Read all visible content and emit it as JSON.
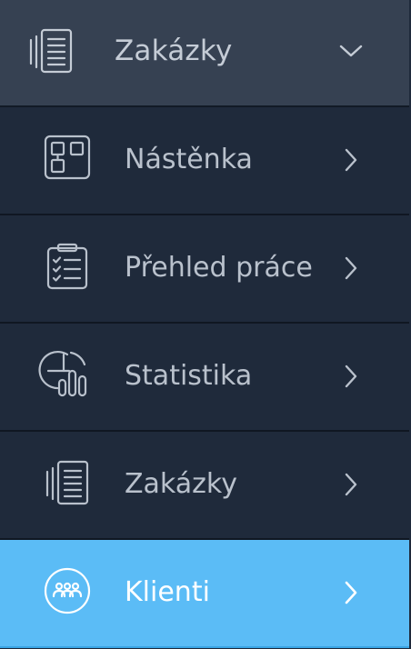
{
  "header": {
    "label": "Zakázky",
    "icon": "document-list-icon",
    "chevron": "chevron-down-icon"
  },
  "items": [
    {
      "label": "Nástěnka",
      "icon": "dashboard-icon",
      "chevron": "chevron-right-icon",
      "active": false
    },
    {
      "label": "Přehled práce",
      "icon": "clipboard-checklist-icon",
      "chevron": "chevron-right-icon",
      "active": false
    },
    {
      "label": "Statistika",
      "icon": "pie-bar-chart-icon",
      "chevron": "chevron-right-icon",
      "active": false
    },
    {
      "label": "Zakázky",
      "icon": "document-list-icon",
      "chevron": "chevron-right-icon",
      "active": false
    },
    {
      "label": "Klienti",
      "icon": "clients-group-icon",
      "chevron": "chevron-right-icon",
      "active": true
    }
  ],
  "colors": {
    "header_bg": "#364152",
    "item_bg": "#1f2a3b",
    "active_bg": "#5bbcf6",
    "text": "#b9c1cc",
    "active_text": "#ffffff"
  }
}
